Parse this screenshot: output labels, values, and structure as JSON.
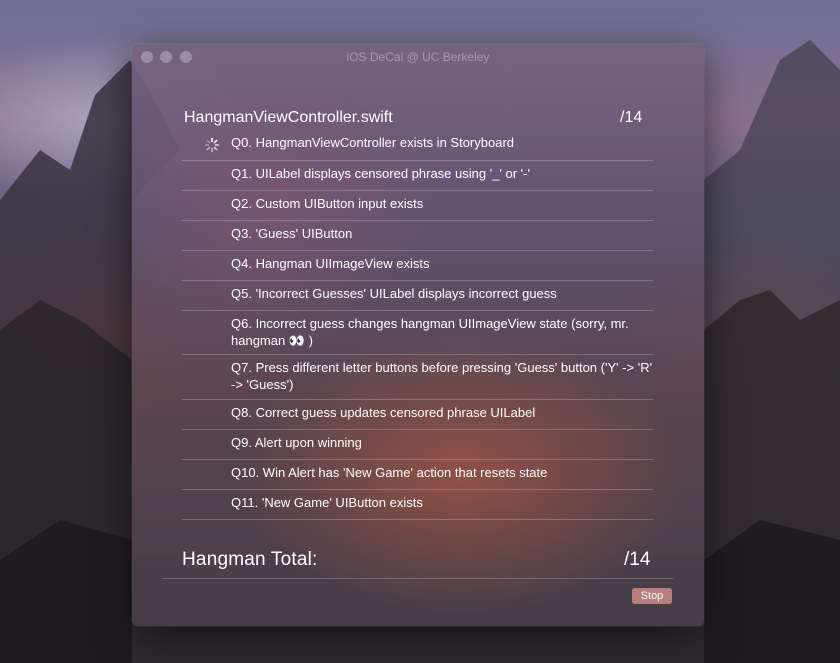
{
  "window": {
    "title": "iOS DeCal @ UC Berkeley"
  },
  "section": {
    "title": "HangmanViewController.swift",
    "score": "/14"
  },
  "questions": [
    {
      "label": "Q0. HangmanViewController exists in Storyboard",
      "status": "running"
    },
    {
      "label": "Q1. UILabel displays censored phrase using '_' or '-'"
    },
    {
      "label": "Q2. Custom UIButton input exists"
    },
    {
      "label": "Q3. 'Guess' UIButton"
    },
    {
      "label": "Q4. Hangman UIImageView exists"
    },
    {
      "label": "Q5. 'Incorrect Guesses' UILabel displays incorrect guess"
    },
    {
      "label": "Q6. Incorrect guess changes hangman UIImageView state (sorry, mr. hangman 👀 )"
    },
    {
      "label": "Q7. Press different letter buttons before pressing 'Guess' button ('Y' -> 'R' -> 'Guess')"
    },
    {
      "label": "Q8. Correct guess updates censored phrase UILabel"
    },
    {
      "label": "Q9. Alert upon winning"
    },
    {
      "label": "Q10. Win Alert has 'New Game' action that resets state"
    },
    {
      "label": "Q11. 'New Game' UIButton exists"
    }
  ],
  "total": {
    "label": "Hangman Total:",
    "score": "/14"
  },
  "buttons": {
    "stop": "Stop"
  },
  "colors": {
    "stop_button": "#d9968c"
  }
}
